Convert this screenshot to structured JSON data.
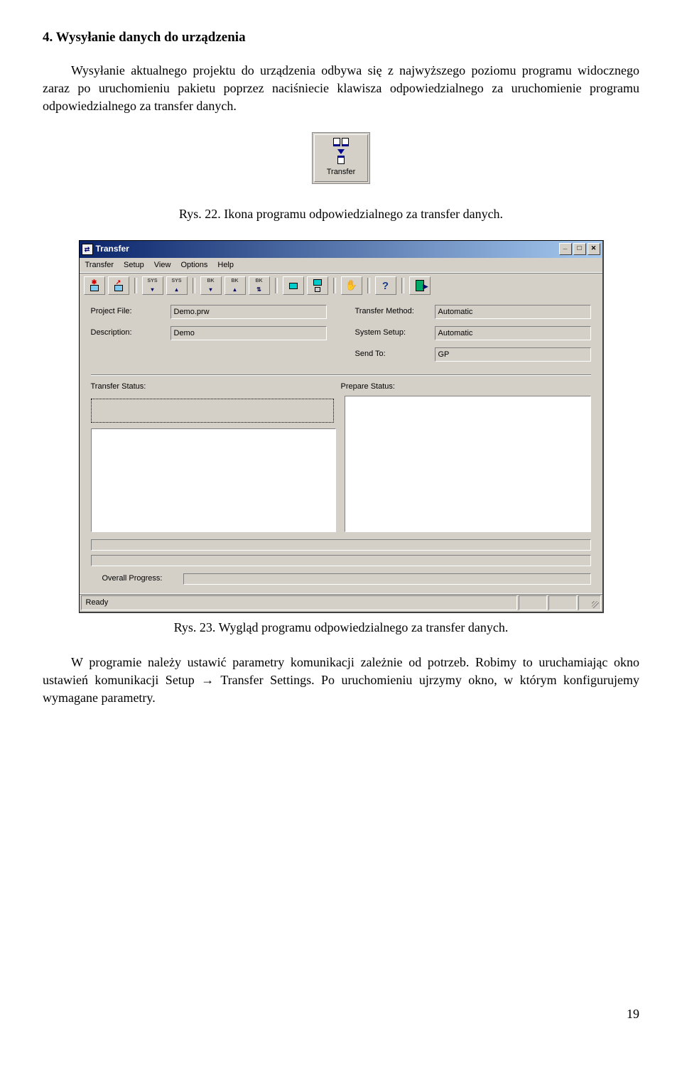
{
  "heading": "4. Wysyłanie danych do urządzenia",
  "para1": "Wysyłanie aktualnego projektu do urządzenia odbywa się z najwyższego poziomu programu widocznego zaraz po uruchomieniu pakietu poprzez naciśniecie klawisza odpowiedzialnego za uruchomienie programu odpowiedzialnego za transfer danych.",
  "icon_button": {
    "label": "Transfer"
  },
  "caption1": "Rys. 22. Ikona programu odpowiedzialnego za transfer danych.",
  "window": {
    "title": "Transfer",
    "menu": [
      "Transfer",
      "Setup",
      "View",
      "Options",
      "Help"
    ],
    "left_fields": {
      "project_file": {
        "label": "Project File:",
        "value": "Demo.prw"
      },
      "description": {
        "label": "Description:",
        "value": "Demo"
      }
    },
    "right_fields": {
      "transfer_method": {
        "label": "Transfer Method:",
        "value": "Automatic"
      },
      "system_setup": {
        "label": "System Setup:",
        "value": "Automatic"
      },
      "send_to": {
        "label": "Send To:",
        "value": "GP"
      }
    },
    "status_labels": {
      "transfer": "Transfer Status:",
      "prepare": "Prepare Status:"
    },
    "overall": "Overall Progress:",
    "statusbar": "Ready"
  },
  "caption2": "Rys. 23. Wygląd programu odpowiedzialnego za transfer danych.",
  "para2": "W programie należy ustawić parametry komunikacji zależnie od potrzeb. Robimy to uruchamiając okno ustawień komunikacji Setup → Transfer Settings. Po uruchomieniu ujrzymy okno, w którym konfigurujemy wymagane parametry.",
  "page_number": "19"
}
